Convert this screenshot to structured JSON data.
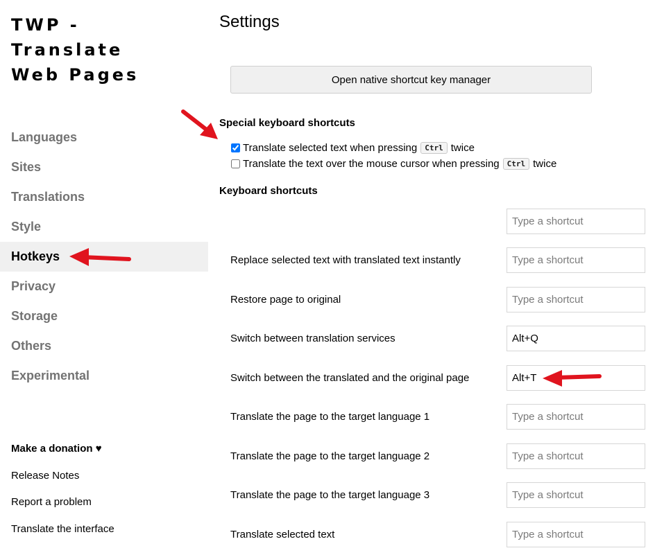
{
  "app": {
    "title_line1": "TWP - Translate",
    "title_line2": "Web Pages"
  },
  "sidebar": {
    "items": [
      {
        "label": "Languages"
      },
      {
        "label": "Sites"
      },
      {
        "label": "Translations"
      },
      {
        "label": "Style"
      },
      {
        "label": "Hotkeys",
        "active": true
      },
      {
        "label": "Privacy"
      },
      {
        "label": "Storage"
      },
      {
        "label": "Others"
      },
      {
        "label": "Experimental"
      }
    ],
    "footer": {
      "donation": "Make a donation",
      "heart_icon": "♥",
      "release_notes": "Release Notes",
      "report": "Report a problem",
      "translate_ui": "Translate the interface"
    }
  },
  "main": {
    "title": "Settings",
    "native_button": "Open native shortcut key manager",
    "special_heading": "Special keyboard shortcuts",
    "special": [
      {
        "before": "Translate selected text when pressing",
        "key": "Ctrl",
        "after": "twice",
        "checked": true
      },
      {
        "before": "Translate the text over the mouse cursor when pressing",
        "key": "Ctrl",
        "after": "twice",
        "checked": false
      }
    ],
    "shortcuts_heading": "Keyboard shortcuts",
    "placeholder": "Type a shortcut",
    "shortcuts": [
      {
        "label": "",
        "value": ""
      },
      {
        "label": "Replace selected text with translated text instantly",
        "value": ""
      },
      {
        "label": "Restore page to original",
        "value": ""
      },
      {
        "label": "Switch between translation services",
        "value": "Alt+Q"
      },
      {
        "label": "Switch between the translated and the original page",
        "value": "Alt+T"
      },
      {
        "label": "Translate the page to the target language 1",
        "value": ""
      },
      {
        "label": "Translate the page to the target language 2",
        "value": ""
      },
      {
        "label": "Translate the page to the target language 3",
        "value": ""
      },
      {
        "label": "Translate selected text",
        "value": ""
      }
    ]
  },
  "colors": {
    "annotation_arrow": "#e0141e",
    "active_bg": "#f0f0f0",
    "inactive_nav": "#737373"
  }
}
